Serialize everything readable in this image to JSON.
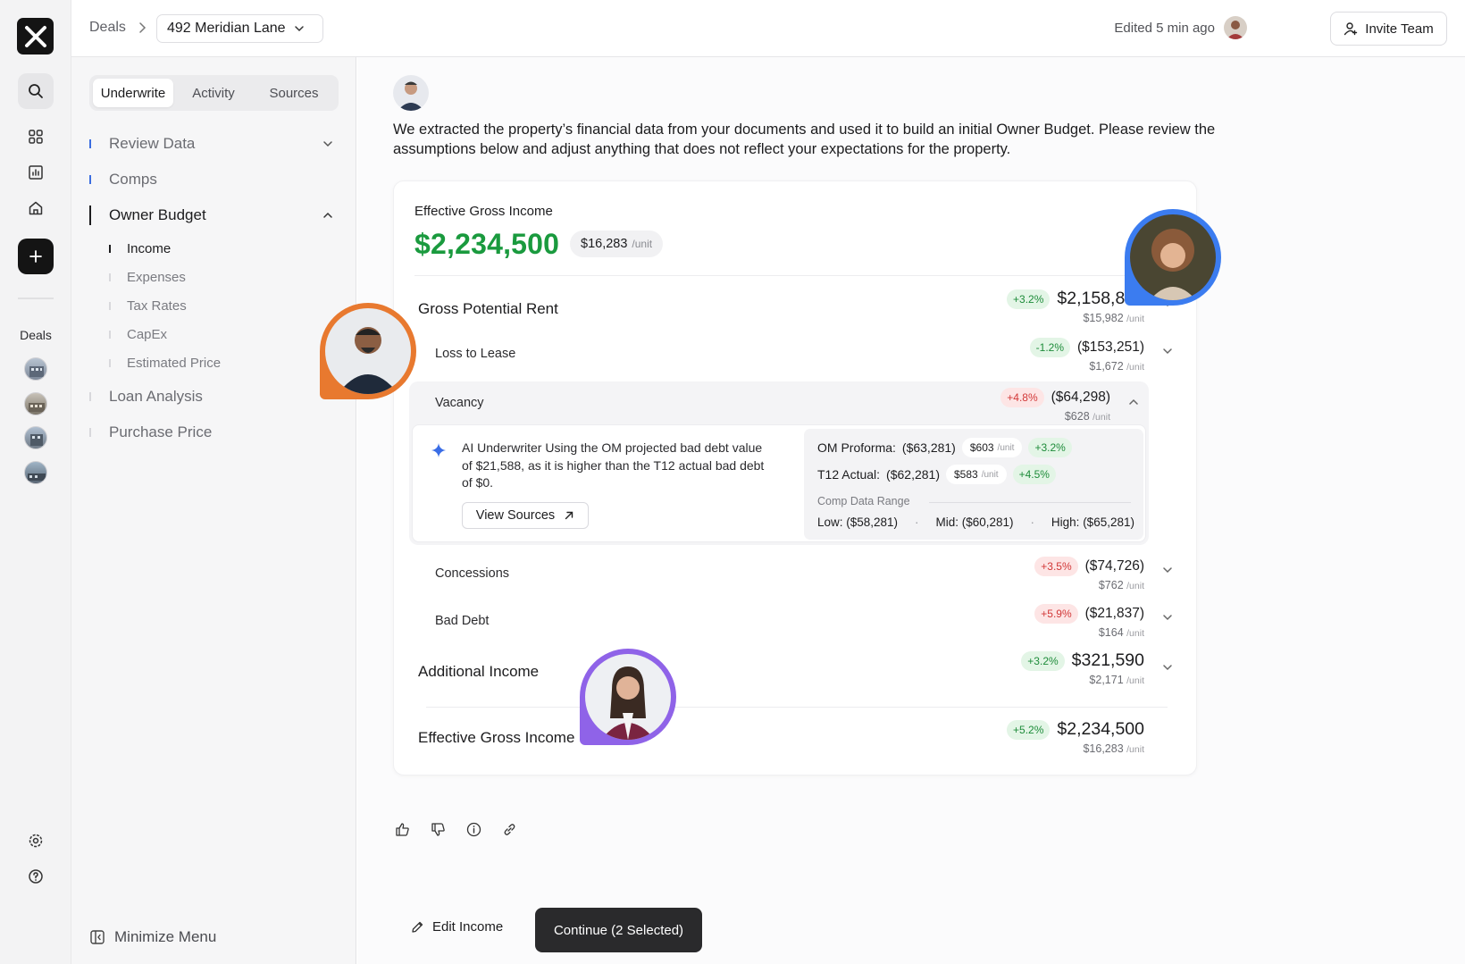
{
  "rail": {
    "deals_label": "Deals"
  },
  "topbar": {
    "crumb": "Deals",
    "deal_name": "492 Meridian Lane",
    "edited": "Edited 5 min ago",
    "invite_label": "Invite Team"
  },
  "panel": {
    "tabs": [
      {
        "label": "Underwrite"
      },
      {
        "label": "Activity"
      },
      {
        "label": "Sources"
      }
    ],
    "nav": [
      {
        "label": "Review Data"
      },
      {
        "label": "Comps"
      },
      {
        "label": "Owner Budget"
      },
      {
        "label": "Loan Analysis"
      },
      {
        "label": "Purchase Price"
      }
    ],
    "sub": [
      {
        "label": "Income"
      },
      {
        "label": "Expenses"
      },
      {
        "label": "Tax Rates"
      },
      {
        "label": "CapEx"
      },
      {
        "label": "Estimated Price"
      }
    ],
    "minimize_label": "Minimize Menu"
  },
  "main": {
    "intro": "We extracted the property’s financial data from your documents and used it to build an initial Owner Budget. Please review the assumptions below and adjust anything that does not reflect your expectations for the property.",
    "egi": {
      "label": "Effective Gross Income",
      "value": "$2,234,500",
      "unit_value": "$16,283",
      "unit_suffix": "/unit"
    },
    "rows": {
      "gpr": {
        "label": "Gross Potential Rent",
        "pct": "+3.2%",
        "amount": "$2,158,800",
        "per": "$15,982",
        "u": "/unit"
      },
      "ltl": {
        "label": "Loss to Lease",
        "pct": "-1.2%",
        "amount": "($153,251)",
        "per": "$1,672",
        "u": "/unit"
      },
      "vac": {
        "label": "Vacancy",
        "pct": "+4.8%",
        "amount": "($64,298)",
        "per": "$628",
        "u": "/unit"
      },
      "con": {
        "label": "Concessions",
        "pct": "+3.5%",
        "amount": "($74,726)",
        "per": "$762",
        "u": "/unit"
      },
      "bad": {
        "label": "Bad Debt",
        "pct": "+5.9%",
        "amount": "($21,837)",
        "per": "$164",
        "u": "/unit"
      },
      "add": {
        "label": "Additional Income",
        "pct": "+3.2%",
        "amount": "$321,590",
        "per": "$2,171",
        "u": "/unit"
      },
      "egi": {
        "label": "Effective Gross Income",
        "pct": "+5.2%",
        "amount": "$2,234,500",
        "per": "$16,283",
        "u": "/unit"
      }
    },
    "vacancy_detail": {
      "ai_text": "AI Underwriter Using the OM projected bad debt value of $21,588, as it is higher than the T12 actual bad debt of $0.",
      "view_sources": "View Sources",
      "om": {
        "label": "OM Proforma:",
        "value": "($63,281)",
        "unit": "$603",
        "u": "/unit",
        "pct": "+3.2%"
      },
      "t12": {
        "label": "T12 Actual:",
        "value": "($62,281)",
        "unit": "$583",
        "u": "/unit",
        "pct": "+4.5%"
      },
      "comp_label": "Comp Data Range",
      "low": "Low:  ($58,281)",
      "mid": "Mid:  ($60,281)",
      "high": "High:  ($65,281)"
    },
    "edit_income": "Edit Income",
    "continue": "Continue (2 Selected)"
  },
  "colors": {
    "accent_green": "#1a9a3e",
    "pill_red": "#d23838",
    "avatar_orange": "#e8792f",
    "avatar_blue": "#3b7cf0",
    "avatar_purple": "#8f63e8"
  }
}
